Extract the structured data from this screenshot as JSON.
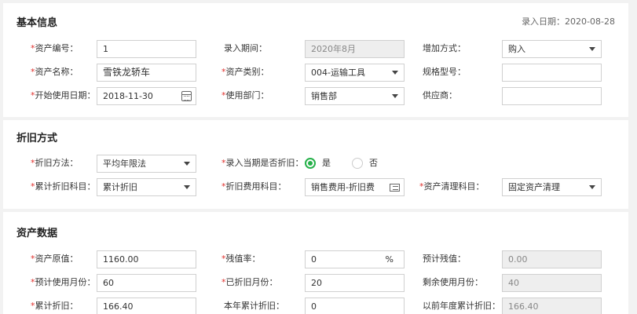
{
  "basic": {
    "title": "基本信息",
    "entry_date": "录入日期：2020-08-28",
    "asset_code_label": "资产编号：",
    "asset_code": "1",
    "entry_period_label": "录入期间：",
    "entry_period": "2020年8月",
    "add_method_label": "增加方式：",
    "add_method": "购入",
    "asset_name_label": "资产名称：",
    "asset_name": "雪铁龙轿车",
    "asset_category_label": "资产类别：",
    "asset_category": "004-运输工具",
    "spec_label": "规格型号：",
    "spec": "",
    "start_date_label": "开始使用日期：",
    "start_date": "2018-11-30",
    "department_label": "使用部门：",
    "department": "销售部",
    "supplier_label": "供应商：",
    "supplier": ""
  },
  "depreciation": {
    "title": "折旧方式",
    "method_label": "折旧方法：",
    "method": "平均年限法",
    "current_period_label": "录入当期是否折旧：",
    "yes_label": "是",
    "no_label": "否",
    "accum_account_label": "累计折旧科目：",
    "accum_account": "累计折旧",
    "expense_account_label": "折旧费用科目：",
    "expense_account": "销售费用-折旧费",
    "clearing_account_label": "资产清理科目：",
    "clearing_account": "固定资产清理"
  },
  "asset_data": {
    "title": "资产数据",
    "original_value_label": "资产原值：",
    "original_value": "1160.00",
    "residual_rate_label": "残值率：",
    "residual_rate": "0",
    "percent_sign": "%",
    "est_residual_label": "预计残值：",
    "est_residual": "0.00",
    "est_months_label": "预计使用月份：",
    "est_months": "60",
    "depreciated_months_label": "已折旧月份：",
    "depreciated_months": "20",
    "remaining_months_label": "剩余使用月份：",
    "remaining_months": "40",
    "accum_dep_label": "累计折旧：",
    "accum_dep": "166.40",
    "year_accum_label": "本年累计折旧：",
    "year_accum": "0",
    "prior_years_label": "以前年度累计折旧：",
    "prior_years": "166.40"
  },
  "required_mark": "*",
  "colors": {
    "required": "#e0302c",
    "radio_on": "#26b14a"
  }
}
